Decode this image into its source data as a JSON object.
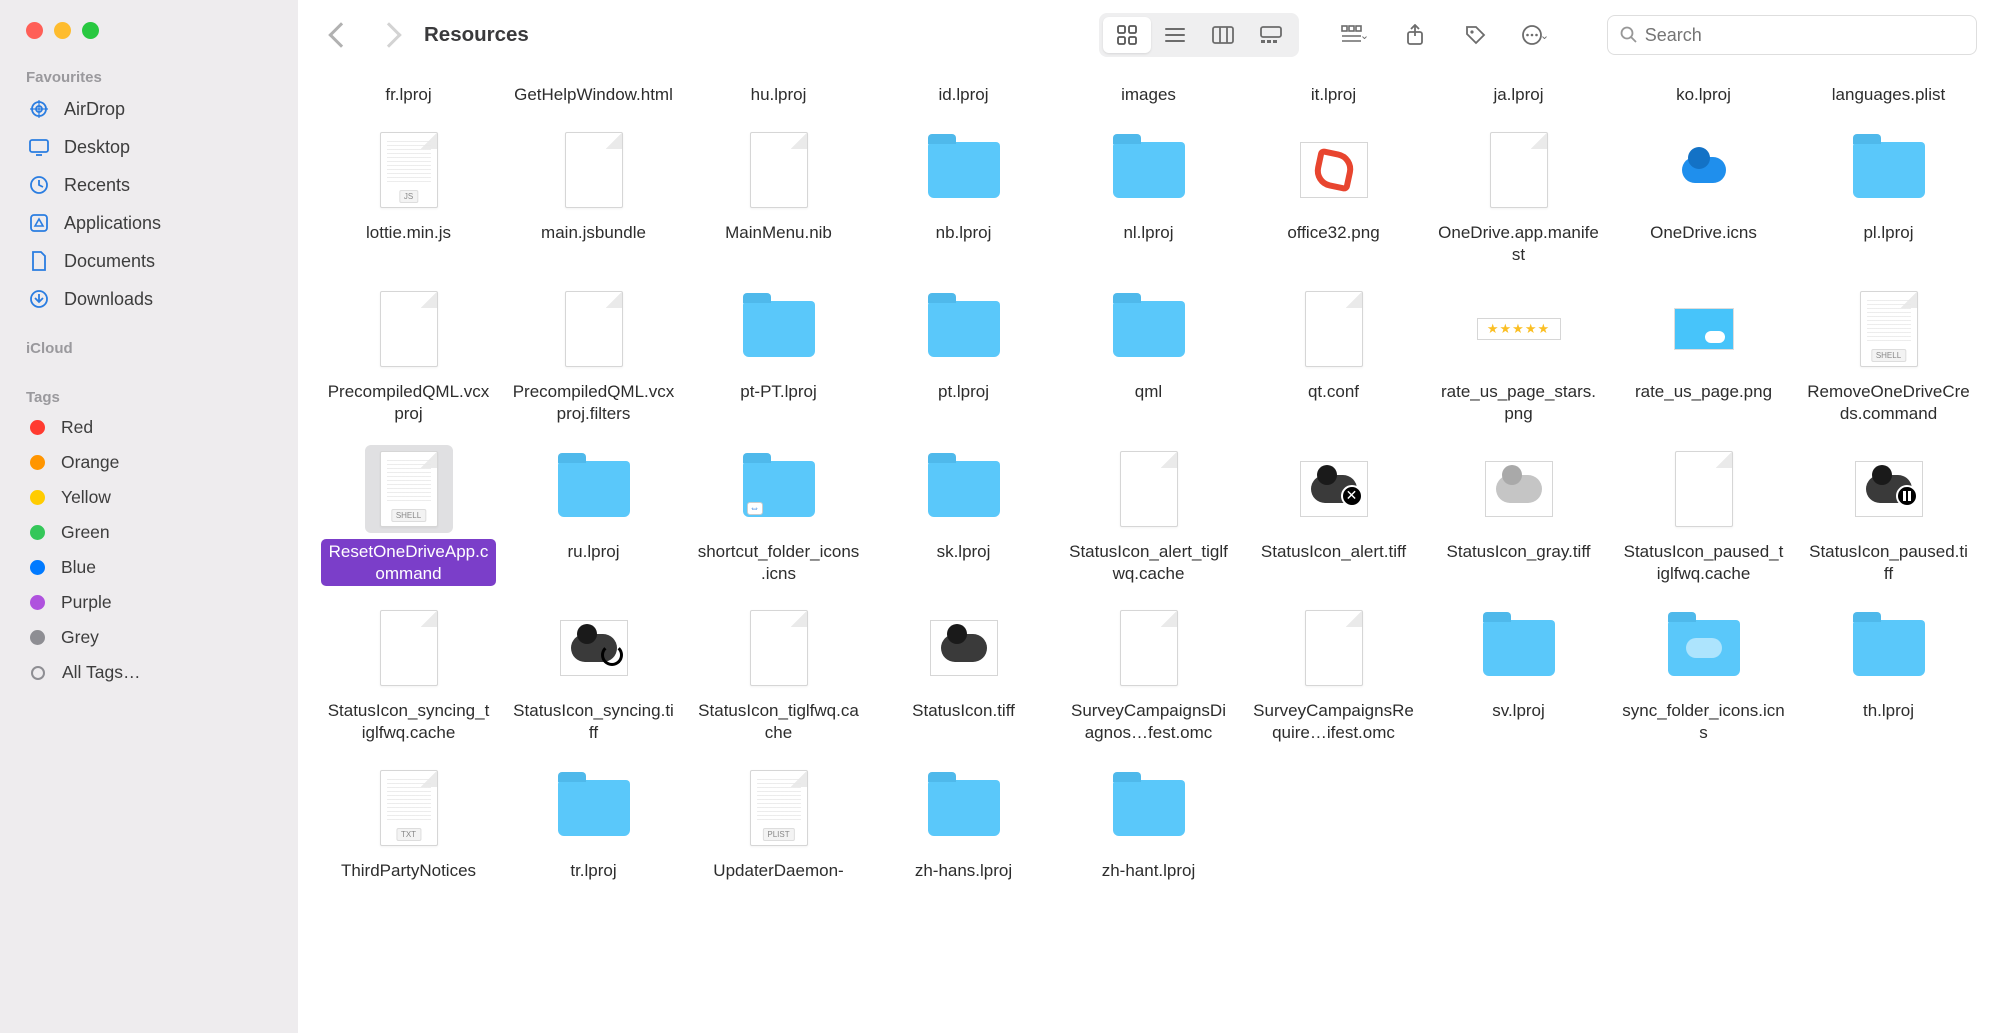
{
  "window": {
    "title": "Resources"
  },
  "search": {
    "placeholder": "Search"
  },
  "sidebar": {
    "favourites_header": "Favourites",
    "icloud_header": "iCloud",
    "tags_header": "Tags",
    "items": [
      {
        "label": "AirDrop"
      },
      {
        "label": "Desktop"
      },
      {
        "label": "Recents"
      },
      {
        "label": "Applications"
      },
      {
        "label": "Documents"
      },
      {
        "label": "Downloads"
      }
    ],
    "tags": [
      {
        "label": "Red",
        "color": "#ff3b30"
      },
      {
        "label": "Orange",
        "color": "#ff9500"
      },
      {
        "label": "Yellow",
        "color": "#ffcc00"
      },
      {
        "label": "Green",
        "color": "#34c759"
      },
      {
        "label": "Blue",
        "color": "#007aff"
      },
      {
        "label": "Purple",
        "color": "#af52de"
      },
      {
        "label": "Grey",
        "color": "#8e8e93"
      }
    ],
    "all_tags": "All Tags…"
  },
  "files": [
    {
      "name": "fr.lproj",
      "kind": "label"
    },
    {
      "name": "GetHelpWindow.html",
      "kind": "label"
    },
    {
      "name": "hu.lproj",
      "kind": "label"
    },
    {
      "name": "id.lproj",
      "kind": "label"
    },
    {
      "name": "images",
      "kind": "label"
    },
    {
      "name": "it.lproj",
      "kind": "label"
    },
    {
      "name": "ja.lproj",
      "kind": "label"
    },
    {
      "name": "ko.lproj",
      "kind": "label"
    },
    {
      "name": "languages.plist",
      "kind": "label"
    },
    {
      "name": "lottie.min.js",
      "kind": "doc",
      "badge": "JS",
      "lines": true
    },
    {
      "name": "main.jsbundle",
      "kind": "doc"
    },
    {
      "name": "MainMenu.nib",
      "kind": "doc"
    },
    {
      "name": "nb.lproj",
      "kind": "folder"
    },
    {
      "name": "nl.lproj",
      "kind": "folder"
    },
    {
      "name": "office32.png",
      "kind": "office"
    },
    {
      "name": "OneDrive.app.manifest",
      "kind": "doc"
    },
    {
      "name": "OneDrive.icns",
      "kind": "onedrive"
    },
    {
      "name": "pl.lproj",
      "kind": "folder"
    },
    {
      "name": "PrecompiledQML.vcxproj",
      "kind": "doc"
    },
    {
      "name": "PrecompiledQML.vcxproj.filters",
      "kind": "doc"
    },
    {
      "name": "pt-PT.lproj",
      "kind": "folder"
    },
    {
      "name": "pt.lproj",
      "kind": "folder"
    },
    {
      "name": "qml",
      "kind": "folder"
    },
    {
      "name": "qt.conf",
      "kind": "doc"
    },
    {
      "name": "rate_us_page_stars.png",
      "kind": "stars"
    },
    {
      "name": "rate_us_page.png",
      "kind": "sky"
    },
    {
      "name": "RemoveOneDriveCreds.command",
      "kind": "doc",
      "badge": "SHELL",
      "lines": true
    },
    {
      "name": "ResetOneDriveApp.command",
      "kind": "doc",
      "badge": "SHELL",
      "lines": true,
      "selected": true
    },
    {
      "name": "ru.lproj",
      "kind": "folder"
    },
    {
      "name": "shortcut_folder_icons.icns",
      "kind": "folder",
      "link": true
    },
    {
      "name": "sk.lproj",
      "kind": "folder"
    },
    {
      "name": "StatusIcon_alert_tiglfwq.cache",
      "kind": "doc"
    },
    {
      "name": "StatusIcon_alert.tiff",
      "kind": "cloud-dark",
      "overlay": "x"
    },
    {
      "name": "StatusIcon_gray.tiff",
      "kind": "cloud-gray"
    },
    {
      "name": "StatusIcon_paused_tiglfwq.cache",
      "kind": "doc"
    },
    {
      "name": "StatusIcon_paused.tiff",
      "kind": "cloud-dark",
      "overlay": "pause"
    },
    {
      "name": "StatusIcon_syncing_tiglfwq.cache",
      "kind": "doc"
    },
    {
      "name": "StatusIcon_syncing.tiff",
      "kind": "cloud-dark",
      "overlay": "sync"
    },
    {
      "name": "StatusIcon_tiglfwq.cache",
      "kind": "doc"
    },
    {
      "name": "StatusIcon.tiff",
      "kind": "cloud-dark"
    },
    {
      "name": "SurveyCampaignsDiagnos…fest.omc",
      "kind": "doc"
    },
    {
      "name": "SurveyCampaignsRequire…ifest.omc",
      "kind": "doc"
    },
    {
      "name": "sv.lproj",
      "kind": "folder"
    },
    {
      "name": "sync_folder_icons.icns",
      "kind": "folder",
      "cloud": true
    },
    {
      "name": "th.lproj",
      "kind": "folder"
    },
    {
      "name": "ThirdPartyNotices",
      "kind": "doc",
      "badge": "TXT",
      "lines": true
    },
    {
      "name": "tr.lproj",
      "kind": "folder"
    },
    {
      "name": "UpdaterDaemon-",
      "kind": "doc",
      "badge": "PLIST",
      "lines": true
    },
    {
      "name": "zh-hans.lproj",
      "kind": "folder"
    },
    {
      "name": "zh-hant.lproj",
      "kind": "folder"
    }
  ]
}
